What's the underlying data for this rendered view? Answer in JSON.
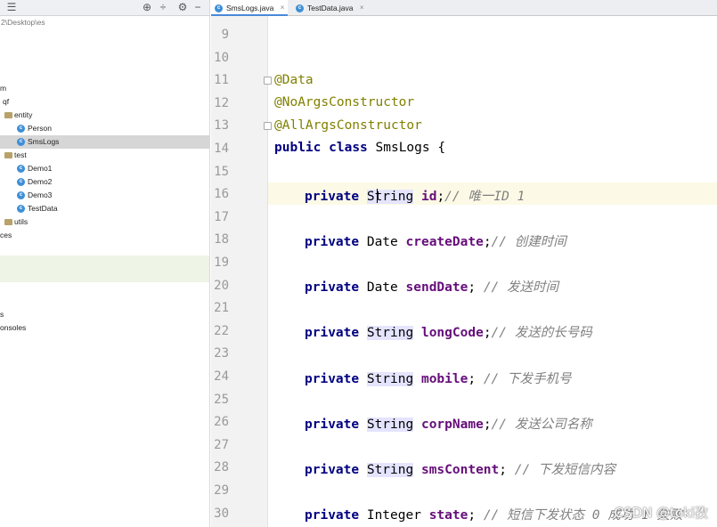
{
  "sidebar": {
    "path_text": "2\\Desktop\\es",
    "items": [
      {
        "label": "m",
        "type": "none"
      },
      {
        "label": "qf",
        "type": "none"
      },
      {
        "label": "entity",
        "type": "folder"
      },
      {
        "label": "Person",
        "type": "class"
      },
      {
        "label": "SmsLogs",
        "type": "class"
      },
      {
        "label": "test",
        "type": "folder"
      },
      {
        "label": "Demo1",
        "type": "class"
      },
      {
        "label": "Demo2",
        "type": "class"
      },
      {
        "label": "Demo3",
        "type": "class"
      },
      {
        "label": "TestData",
        "type": "class"
      },
      {
        "label": "utils",
        "type": "folder"
      },
      {
        "label": "ces",
        "type": "none"
      },
      {
        "label": "s",
        "type": "none"
      },
      {
        "label": "onsoles",
        "type": "none"
      }
    ]
  },
  "tabs": [
    {
      "label": "SmsLogs.java",
      "close": "×"
    },
    {
      "label": "TestData.java",
      "close": "×"
    }
  ],
  "line_numbers": [
    "9",
    "10",
    "11",
    "12",
    "13",
    "14",
    "15",
    "16",
    "17",
    "18",
    "19",
    "20",
    "21",
    "22",
    "23",
    "24",
    "25",
    "26",
    "27",
    "28",
    "29",
    "30"
  ],
  "code": {
    "ann_data": "@Data",
    "ann_noargs": "@NoArgsConstructor",
    "ann_allargs": "@AllArgsConstructor",
    "kw_public": "public",
    "kw_class": "class",
    "class_name": "SmsLogs {",
    "kw_private": "private",
    "type_string": "String",
    "type_date": "Date",
    "type_integer": "Integer",
    "f_id": "id",
    "f_createDate": "createDate",
    "f_sendDate": "sendDate",
    "f_longCode": "longCode",
    "f_mobile": "mobile",
    "f_corpName": "corpName",
    "f_smsContent": "smsContent",
    "f_state": "state",
    "c_id": "// 唯一ID 1",
    "c_createDate": "// 创建时间",
    "c_sendDate": "// 发送时间",
    "c_longCode": "// 发送的长号码",
    "c_mobile": "// 下发手机号",
    "c_corpName": "// 发送公司名称",
    "c_smsContent": "// 下发短信内容",
    "c_state": "// 短信下发状态 0 成功 1 失败"
  },
  "watermark": "CSDN @toki孜",
  "colors": {
    "keyword": "#000080",
    "annotation": "#808000",
    "field": "#660e7a",
    "comment": "#808080",
    "current_line": "#fcfae6",
    "selection": "#d6d6d6",
    "tab_accent": "#4a88d8"
  }
}
